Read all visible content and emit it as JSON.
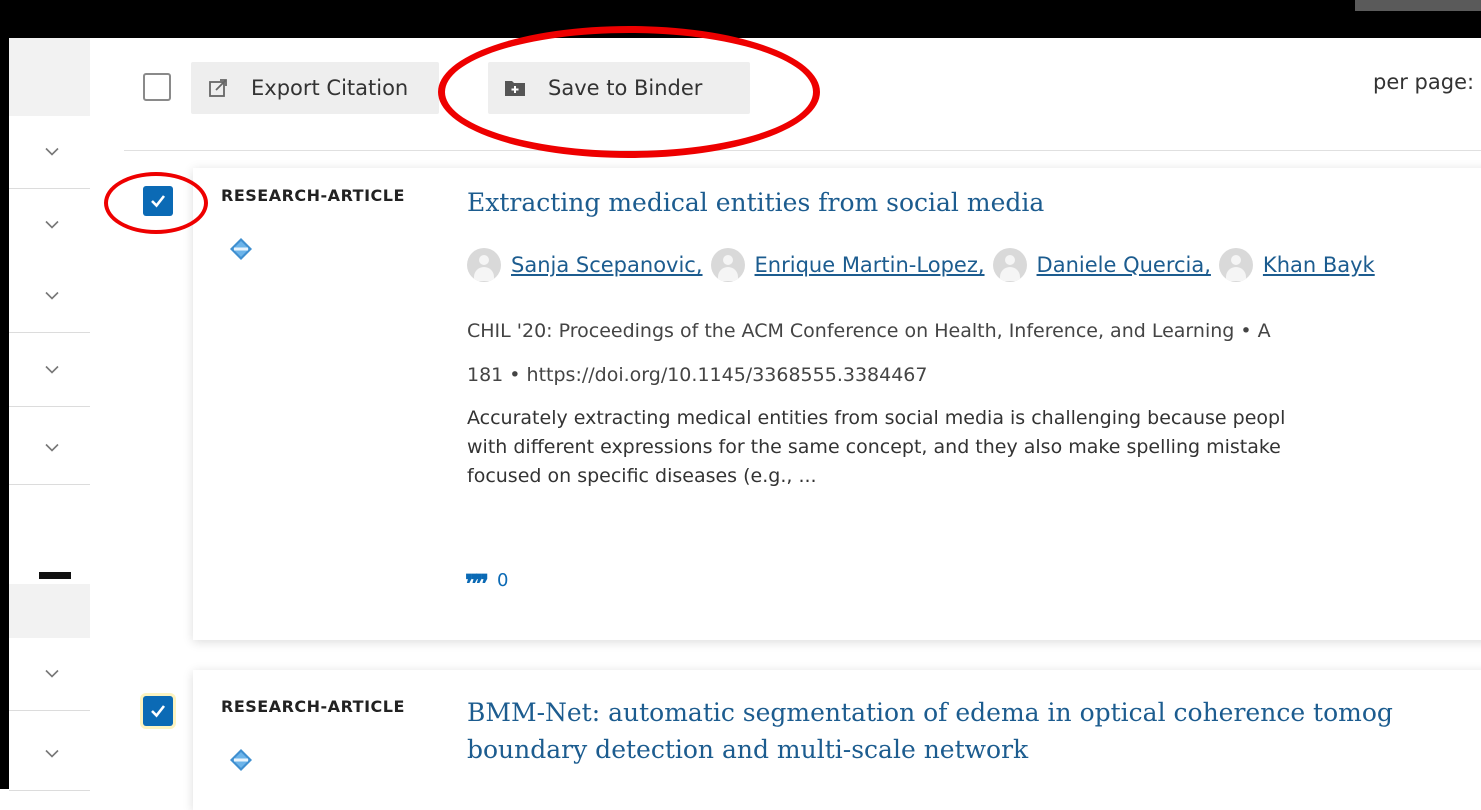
{
  "toolbar": {
    "export_label": "Export Citation",
    "save_label": "Save to Binder",
    "per_page_label": "per page:"
  },
  "results": [
    {
      "selected": true,
      "type": "RESEARCH-ARTICLE",
      "title": "Extracting medical entities from social media",
      "authors": [
        "Sanja Scepanovic,",
        "Enrique Martin-Lopez,",
        "Daniele Quercia,",
        "Khan Bayk"
      ],
      "venue": "CHIL '20: Proceedings of the ACM Conference on Health, Inference, and Learning • A",
      "pages_doi": "181 • https://doi.org/10.1145/3368555.3384467",
      "abstract_lines": [
        "Accurately extracting medical entities from social media is challenging because peopl",
        "with different expressions for the same concept, and they also make spelling mistake",
        "focused on specific diseases (e.g., ..."
      ],
      "citations": "0"
    },
    {
      "selected": true,
      "type": "RESEARCH-ARTICLE",
      "title_lines": [
        "BMM-Net: automatic segmentation of edema in optical coherence tomog",
        "boundary detection and multi-scale network"
      ]
    }
  ],
  "icons": {
    "export": "external-link-icon",
    "save": "folder-plus-icon",
    "badge": "acm-diamond-icon",
    "facet": "chevron-down-icon",
    "citation": "quote-icon"
  },
  "colors": {
    "link": "#1c5c8f",
    "checkbox": "#0b6ab5",
    "annotation": "#ee0000"
  }
}
